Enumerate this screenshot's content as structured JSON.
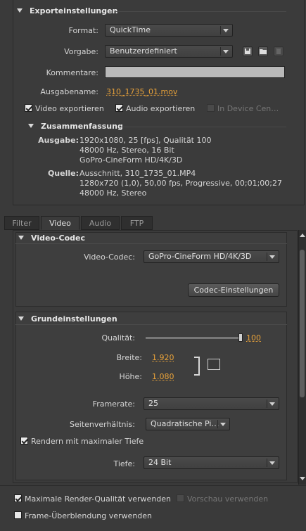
{
  "export_settings": {
    "title": "Exporteinstellungen",
    "format_label": "Format:",
    "format_value": "QuickTime",
    "preset_label": "Vorgabe:",
    "preset_value": "Benutzerdefiniert",
    "comments_label": "Kommentare:",
    "comments_value": "",
    "output_name_label": "Ausgabename:",
    "output_name_value": "310_1735_01.mov",
    "export_video_label": "Video exportieren",
    "export_audio_label": "Audio exportieren",
    "device_central_label": "In Device Cen…"
  },
  "summary": {
    "title": "Zusammenfassung",
    "output_label": "Ausgabe:",
    "output_lines": [
      "1920x1080, 25 [fps], Qualität 100",
      "48000 Hz, Stereo, 16 Bit",
      "GoPro-CineForm HD/4K/3D"
    ],
    "source_label": "Quelle:",
    "source_lines": [
      "Ausschnitt, 310_1735_01.MP4",
      "1280x720 (1,0), 50,00 fps, Progressive, 00;01;00;27",
      "48000 Hz, Stereo"
    ]
  },
  "tabs": [
    "Filter",
    "Video",
    "Audio",
    "FTP"
  ],
  "video_codec": {
    "title": "Video-Codec",
    "codec_label": "Video-Codec:",
    "codec_value": "GoPro-CineForm HD/4K/3D",
    "codec_settings_button": "Codec-Einstellungen"
  },
  "basic_settings": {
    "title": "Grundeinstellungen",
    "quality_label": "Qualität:",
    "quality_value": "100",
    "quality_level": 1.0,
    "width_label": "Breite:",
    "width_value": "1.920",
    "height_label": "Höhe:",
    "height_value": "1.080",
    "framerate_label": "Framerate:",
    "framerate_value": "25",
    "aspect_label": "Seitenverhältnis:",
    "aspect_value": "Quadratische Pi…",
    "render_max_depth_label": "Rendern mit maximaler Tiefe",
    "depth_label": "Tiefe:",
    "depth_value": "24 Bit"
  },
  "bottom": {
    "max_render_quality_label": "Maximale Render-Qualität verwenden",
    "use_preview_label": "Vorschau verwenden",
    "frame_blending_label": "Frame-Überblendung verwenden"
  },
  "colors": {
    "accent": "#e8a23a",
    "panel": "#3b3b3b"
  }
}
